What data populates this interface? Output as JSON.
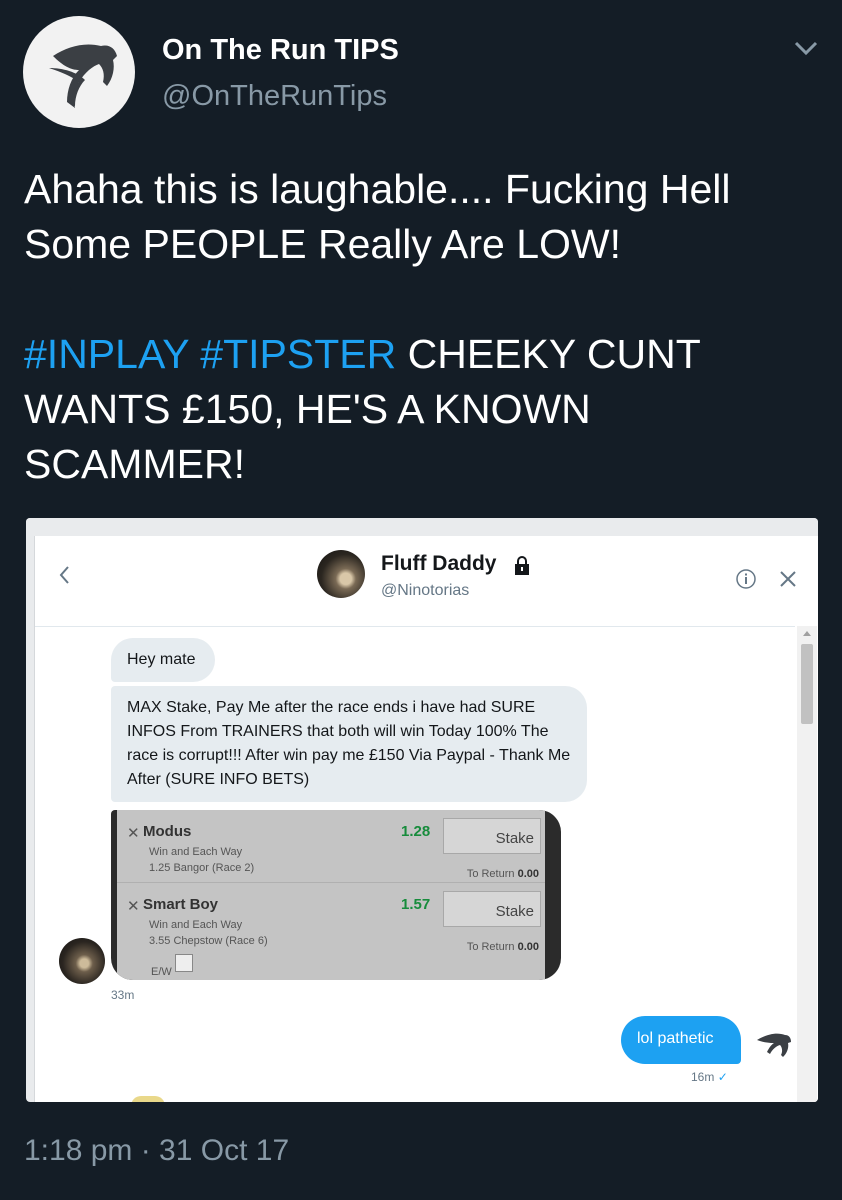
{
  "tweet": {
    "author_name": "On The Run TIPS",
    "author_handle": "@OnTheRunTips",
    "text_line1": "Ahaha this is laughable.... Fucking Hell Some PEOPLE Really Are LOW!",
    "hashtag1": "#INPLAY",
    "hashtag2": "#TIPSTER",
    "text_line2": " CHEEKY CUNT WANTS £150, HE'S A KNOWN SCAMMER!",
    "timestamp": "1:18 pm · 31 Oct 17",
    "icons": [
      "horse-logo-icon",
      "chevron-down-icon"
    ]
  },
  "screenshot": {
    "header": {
      "name": "Fluff Daddy",
      "handle": "@Ninotorias",
      "icons": [
        "back-icon",
        "lock-icon",
        "info-icon",
        "close-icon"
      ]
    },
    "messages": {
      "msg1": "Hey mate",
      "msg2": "MAX Stake, Pay Me after the race ends i have had SURE INFOS From TRAINERS that both will win Today 100% The race is corrupt!!! After win pay me £150 Via Paypal - Thank Me After (SURE INFO BETS)",
      "time_left": "33m",
      "reply": "lol pathetic",
      "time_right": "16m"
    },
    "betslip": {
      "bets": [
        {
          "name": "Modus",
          "type": "Win and Each Way",
          "race": "1.25 Bangor (Race 2)",
          "odds": "1.28",
          "stake": "Stake",
          "return_label": "To Return",
          "return_value": "0.00"
        },
        {
          "name": "Smart Boy",
          "type": "Win and Each Way",
          "race": "3.55 Chepstow (Race 6)",
          "odds": "1.57",
          "stake": "Stake",
          "return_label": "To Return",
          "return_value": "0.00"
        }
      ],
      "ew_label": "E/W"
    }
  },
  "colors": {
    "background": "#141d26",
    "hashtag": "#1da1f2",
    "muted": "#8899a6",
    "reply_bubble": "#1da1f2"
  }
}
